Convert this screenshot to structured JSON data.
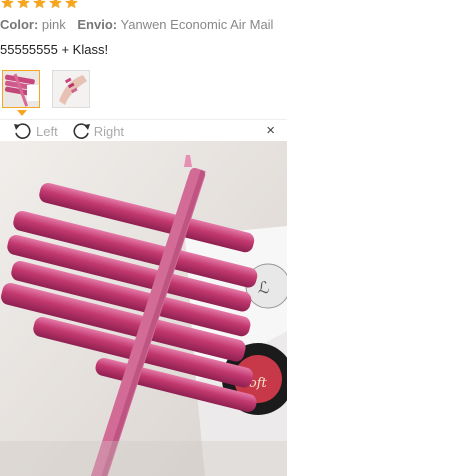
{
  "rating": {
    "stars": 5,
    "max": 5,
    "color": "#f5a623"
  },
  "meta": {
    "color_label": "Color:",
    "color_value": "pink",
    "shipping_label": "Envio:",
    "shipping_value": "Yanwen Economic Air Mail"
  },
  "review_text": "55555555 + Klass!",
  "thumbnails": [
    {
      "icon": "pencil-photo-thumbnail",
      "active": true
    },
    {
      "icon": "hand-swatch-thumbnail",
      "active": false
    }
  ],
  "viewer": {
    "rotate_left_label": "Left",
    "rotate_right_label": "Right",
    "close_symbol": "×",
    "box_brand": "Soft"
  }
}
